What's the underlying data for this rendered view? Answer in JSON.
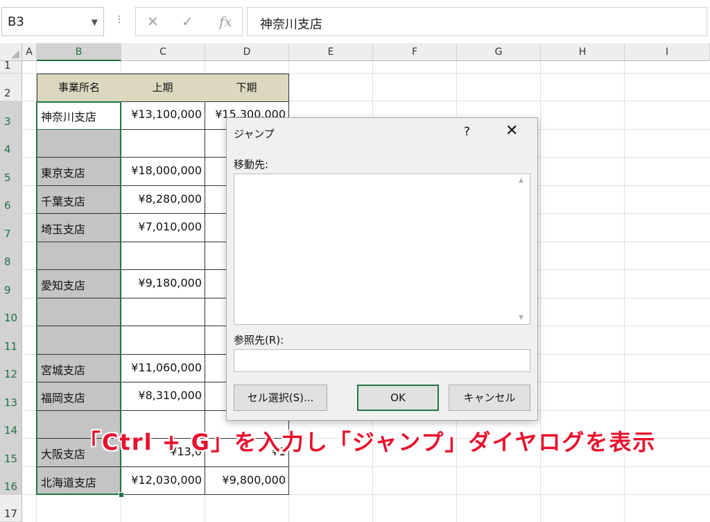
{
  "formula_bar": {
    "name_box": "B3",
    "cancel_icon": "✕",
    "enter_icon": "✓",
    "fx_icon": "fx",
    "content": "神奈川支店"
  },
  "columns": [
    "A",
    "B",
    "C",
    "D",
    "E",
    "F",
    "G",
    "H",
    "I"
  ],
  "rows": [
    "1",
    "2",
    "3",
    "4",
    "5",
    "6",
    "7",
    "8",
    "9",
    "10",
    "11",
    "12",
    "13",
    "14",
    "15",
    "16",
    "17"
  ],
  "table": {
    "headers": [
      "事業所名",
      "上期",
      "下期"
    ],
    "rows": [
      {
        "name": "神奈川支店",
        "h1": "¥13,100,000",
        "h2": "¥15,300,000"
      },
      {
        "name": "",
        "h1": "",
        "h2": ""
      },
      {
        "name": "東京支店",
        "h1": "¥18,000,000",
        "h2": "¥"
      },
      {
        "name": "千葉支店",
        "h1": "¥8,280,000",
        "h2": ""
      },
      {
        "name": "埼玉支店",
        "h1": "¥7,010,000",
        "h2": "¥"
      },
      {
        "name": "",
        "h1": "",
        "h2": ""
      },
      {
        "name": "愛知支店",
        "h1": "¥9,180,000",
        "h2": ""
      },
      {
        "name": "",
        "h1": "",
        "h2": ""
      },
      {
        "name": "",
        "h1": "",
        "h2": ""
      },
      {
        "name": "宮城支店",
        "h1": "¥11,060,000",
        "h2": ""
      },
      {
        "name": "福岡支店",
        "h1": "¥8,310,000",
        "h2": ""
      },
      {
        "name": "",
        "h1": "",
        "h2": ""
      },
      {
        "name": "大阪支店",
        "h1": "¥13,0",
        "h2": "¥1"
      },
      {
        "name": "北海道支店",
        "h1": "¥12,030,000",
        "h2": "¥9,800,000"
      }
    ]
  },
  "dialog": {
    "title": "ジャンプ",
    "help": "?",
    "close": "✕",
    "goto_label": "移動先:",
    "reference_label": "参照先(R):",
    "reference_value": "",
    "special_button": "セル選択(S)...",
    "ok_button": "OK",
    "cancel_button": "キャンセル"
  },
  "caption": "「Ctrl + G」を入力し「ジャンプ」ダイヤログを表示",
  "colors": {
    "selection": "#217346",
    "header_fill": "#dcd8c0",
    "blank_fill": "#c4c4c4",
    "caption": "#e8112d"
  }
}
